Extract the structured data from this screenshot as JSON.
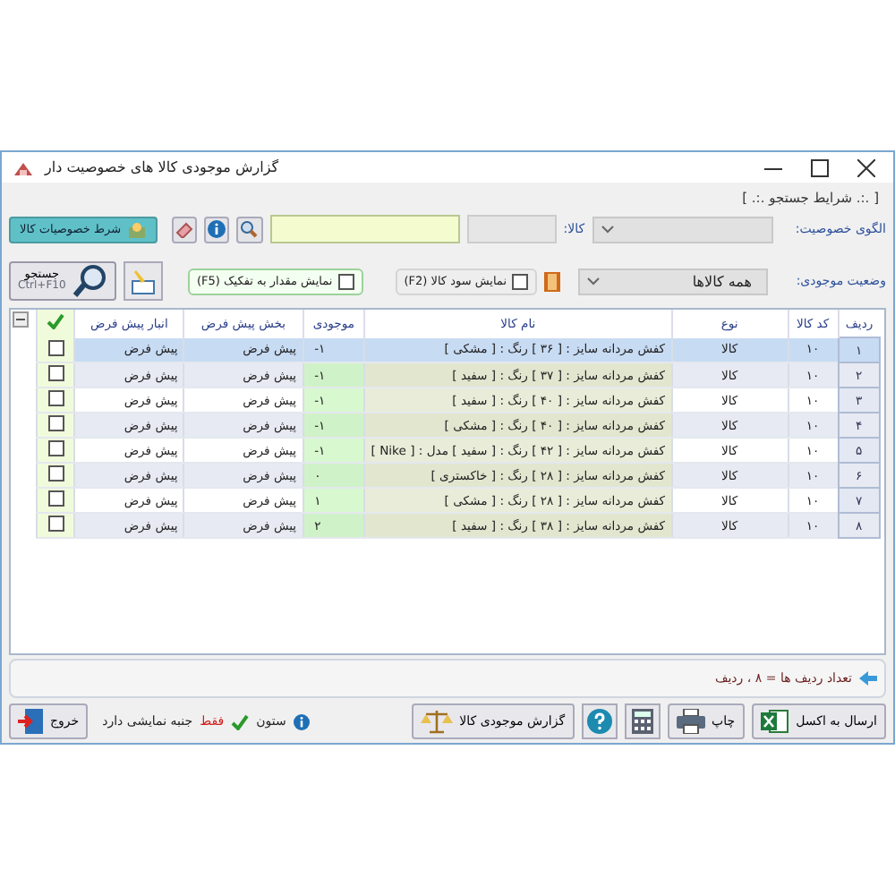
{
  "window": {
    "title": "گزارش موجودی کالا های خصوصیت دار"
  },
  "search_group": {
    "title": "[ .:. شرایط جستجو .:. ]",
    "pattern_label": "الگوی خصوصیت:",
    "product_label": "کالا:",
    "condition_button": "شرط خصوصیات کالا",
    "stock_label": "وضعیت موجودی:",
    "stock_value": "همه کالاها",
    "show_profit": {
      "label": "نمایش سود کالا (F2)",
      "checked": false
    },
    "show_breakdown": {
      "label": "نمایش مقدار به تفکیک (F5)",
      "checked": false
    },
    "search_button": {
      "label": "جستجو",
      "shortcut": "Ctrl+F10"
    }
  },
  "table": {
    "columns": [
      "ردیف",
      "کد کالا",
      "نوع",
      "نام کالا",
      "موجودی",
      "بخش پیش فرض",
      "انبار پیش فرض"
    ],
    "rows": [
      {
        "index": "۱",
        "code": "۱۰",
        "type": "کالا",
        "name": "کفش مردانه سایز : [ ۳۶ ] رنگ : [ مشکی ]",
        "stock": "-۱",
        "section": "پیش فرض",
        "warehouse": "پیش فرض",
        "checked": false,
        "selected": true
      },
      {
        "index": "۲",
        "code": "۱۰",
        "type": "کالا",
        "name": "کفش مردانه سایز : [ ۳۷ ] رنگ : [ سفید ]",
        "stock": "-۱",
        "section": "پیش فرض",
        "warehouse": "پیش فرض",
        "checked": false,
        "selected": false
      },
      {
        "index": "۳",
        "code": "۱۰",
        "type": "کالا",
        "name": "کفش مردانه سایز : [ ۴۰ ] رنگ : [ سفید ]",
        "stock": "-۱",
        "section": "پیش فرض",
        "warehouse": "پیش فرض",
        "checked": false,
        "selected": false
      },
      {
        "index": "۴",
        "code": "۱۰",
        "type": "کالا",
        "name": "کفش مردانه سایز : [ ۴۰ ] رنگ : [ مشکی ]",
        "stock": "-۱",
        "section": "پیش فرض",
        "warehouse": "پیش فرض",
        "checked": false,
        "selected": false
      },
      {
        "index": "۵",
        "code": "۱۰",
        "type": "کالا",
        "name": "کفش مردانه سایز : [ ۴۲ ] رنگ : [ سفید ] مدل : [ Nike ]",
        "stock": "-۱",
        "section": "پیش فرض",
        "warehouse": "پیش فرض",
        "checked": false,
        "selected": false
      },
      {
        "index": "۶",
        "code": "۱۰",
        "type": "کالا",
        "name": "کفش مردانه سایز : [ ۲۸ ] رنگ : [ خاکستری ]",
        "stock": "۰",
        "section": "پیش فرض",
        "warehouse": "پیش فرض",
        "checked": false,
        "selected": false
      },
      {
        "index": "۷",
        "code": "۱۰",
        "type": "کالا",
        "name": "کفش مردانه سایز : [ ۲۸ ] رنگ : [ مشکی ]",
        "stock": "۱",
        "section": "پیش فرض",
        "warehouse": "پیش فرض",
        "checked": false,
        "selected": false
      },
      {
        "index": "۸",
        "code": "۱۰",
        "type": "کالا",
        "name": "کفش مردانه سایز : [ ۳۸ ] رنگ : [ سفید ]",
        "stock": "۲",
        "section": "پیش فرض",
        "warehouse": "پیش فرض",
        "checked": false,
        "selected": false
      }
    ]
  },
  "status": {
    "row_count": "تعداد ردیف ها = ۸ ، ردیف"
  },
  "buttons": {
    "excel": "ارسال به اکسل",
    "print": "چاپ",
    "stock_report": "گزارش موجودی کالا",
    "exit": "خروج"
  },
  "note": {
    "before": "ستون",
    "highlight": "فقط",
    "after": "جنبه نمایشی دارد"
  }
}
